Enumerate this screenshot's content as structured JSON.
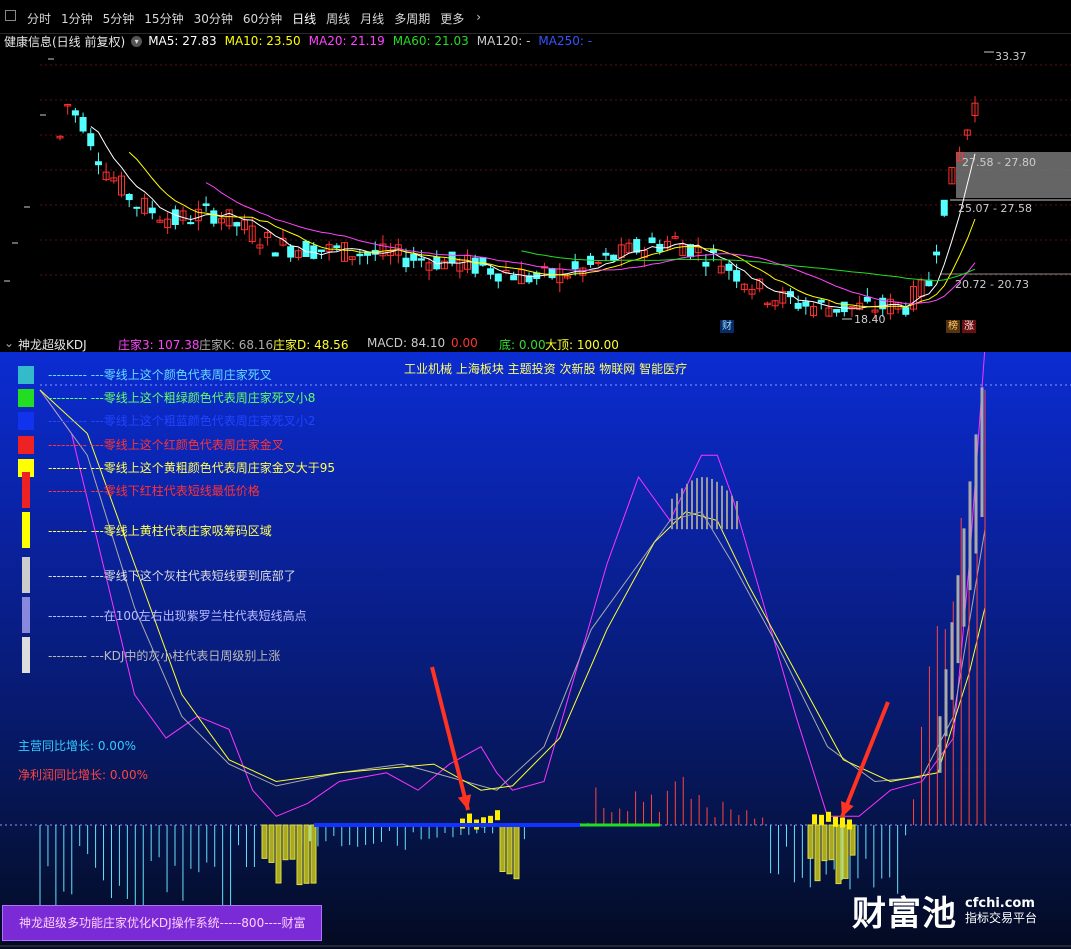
{
  "toolbar": {
    "tabs": [
      {
        "label": "分时"
      },
      {
        "label": "1分钟"
      },
      {
        "label": "5分钟"
      },
      {
        "label": "15分钟"
      },
      {
        "label": "30分钟"
      },
      {
        "label": "60分钟"
      },
      {
        "label": "日线",
        "active": true
      },
      {
        "label": "周线"
      },
      {
        "label": "月线"
      },
      {
        "label": "多周期"
      },
      {
        "label": "更多"
      }
    ]
  },
  "main": {
    "stock_title": "健康信息(日线 前复权)",
    "ma": [
      {
        "label": "MA5: 27.83",
        "color": "#ffffff"
      },
      {
        "label": "MA10: 23.50",
        "color": "#ffff00"
      },
      {
        "label": "MA20: 21.19",
        "color": "#ff44ff"
      },
      {
        "label": "MA60: 21.03",
        "color": "#22dd22"
      },
      {
        "label": "MA120: -",
        "color": "#cccccc"
      },
      {
        "label": "MA250: -",
        "color": "#3355ff"
      }
    ],
    "price_high": "33.37",
    "price_low": "18.40",
    "range_labels": [
      "27.58 - 27.80",
      "25.07 - 27.58",
      "20.72 - 20.73"
    ],
    "marker_cai": "财",
    "marker_bang": "榜",
    "marker_zhang": "涨",
    "colors": {
      "up": "#ff3030",
      "down": "#54ffff"
    }
  },
  "sub": {
    "title": "神龙超级KDJ",
    "zhuang3": "庄家3: 107.38",
    "zhuangK": "庄家K: 68.16",
    "zhuangD": "庄家D: 48.56",
    "macd": "MACD: 84.10",
    "macd_val": "0.00",
    "di": "底: 0.00",
    "dading": "大顶: 100.00",
    "news": "工业机械 上海板块 主题投资 次新股 物联网 智能医疗",
    "legend": [
      {
        "text": "--------- ---零线上这个颜色代表周庄家死叉",
        "color": "#66ddff",
        "swatch": "#33bbcc"
      },
      {
        "text": "--------- ---零线上这个粗绿颜色代表周庄家死叉小8",
        "color": "#66ff66",
        "swatch": "#22dd22"
      },
      {
        "text": "--------- ---零线上这个粗蓝颜色代表周庄家死叉小2",
        "color": "#2244ff",
        "swatch": "#1133ee"
      },
      {
        "text": "--------- ---零线上这个红颜色代表周庄家金叉",
        "color": "#ff3333",
        "swatch": "#ee2222"
      },
      {
        "text": "--------- ---零线上这个黄粗颜色代表周庄家金叉大于95",
        "color": "#ffff55",
        "swatch": "#ffff00"
      },
      {
        "text": "--------- ---零线下红柱代表短线最低价格",
        "color": "#ff3333",
        "swatch": "#ee2222"
      },
      {
        "text": "--------- ---零线上黄柱代表庄家吸筹码区域",
        "color": "#ffff55",
        "swatch": "#ffff00"
      },
      {
        "text": "--------- ---零线下这个灰柱代表短线要到底部了",
        "color": "#dddddd",
        "swatch": "#cccccc"
      },
      {
        "text": "--------- ---在100左右出现紫罗兰柱代表短线高点",
        "color": "#bbbbff",
        "swatch": "#8888dd"
      },
      {
        "text": "--------- ---KDJ中的灰小柱代表日周级别上涨",
        "color": "#bbbbbb",
        "swatch": "#dddddd"
      }
    ],
    "stat_revenue": "主营同比增长: 0.00%",
    "stat_profit": "净利润同比增长: 0.00%",
    "promo": "神龙超级多功能庄家优化KDJ操作系统-----800----财富",
    "brand_cn": "财富池",
    "brand_url": "cfchi.com",
    "brand_sub": "指标交易平台"
  }
}
